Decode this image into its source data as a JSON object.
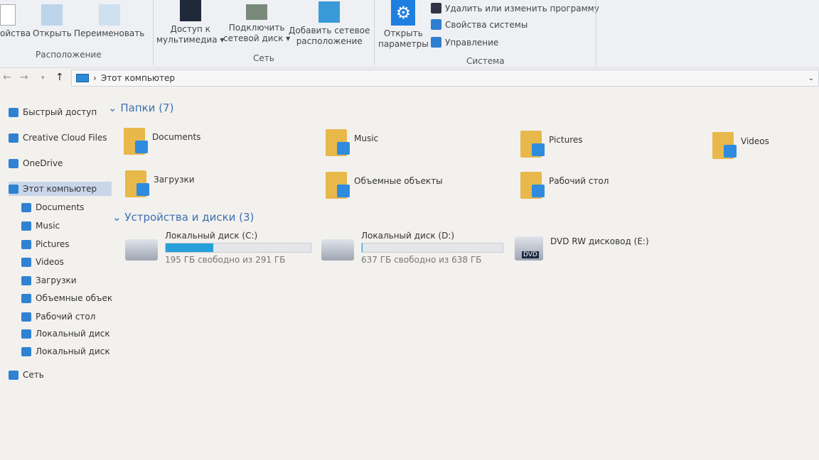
{
  "ribbon": {
    "location": {
      "label": "Расположение",
      "buttons": [
        "ойства",
        "Открыть",
        "Переименовать"
      ]
    },
    "network": {
      "label": "Сеть",
      "buttons": [
        {
          "l1": "Доступ к",
          "l2": "мультимедиа ▾"
        },
        {
          "l1": "Подключить",
          "l2": "сетевой диск ▾"
        },
        {
          "l1": "Добавить сетевое",
          "l2": "расположение"
        }
      ]
    },
    "system": {
      "label": "Система",
      "open": {
        "l1": "Открыть",
        "l2": "параметры"
      },
      "items": [
        "Удалить или изменить программу",
        "Свойства системы",
        "Управление"
      ]
    }
  },
  "address": {
    "path": "Этот компьютер",
    "separator": "›"
  },
  "sidebar": {
    "items": [
      {
        "label": "Быстрый доступ",
        "icon": "star-icon"
      },
      {
        "label": "Creative Cloud Files",
        "icon": "folder-icon"
      },
      {
        "label": "OneDrive",
        "icon": "cloud-icon"
      },
      {
        "label": "Этот компьютер",
        "icon": "computer-icon",
        "selected": true
      },
      {
        "label": "Documents",
        "icon": "documents-icon",
        "sub": true
      },
      {
        "label": "Music",
        "icon": "music-icon",
        "sub": true
      },
      {
        "label": "Pictures",
        "icon": "pictures-icon",
        "sub": true
      },
      {
        "label": "Videos",
        "icon": "videos-icon",
        "sub": true
      },
      {
        "label": "Загрузки",
        "icon": "download-icon",
        "sub": true
      },
      {
        "label": "Объемные объекты",
        "icon": "3d-objects-icon",
        "sub": true
      },
      {
        "label": "Рабочий стол",
        "icon": "desktop-icon",
        "sub": true
      },
      {
        "label": "Локальный диск (C:)",
        "icon": "drive-icon",
        "sub": true
      },
      {
        "label": "Локальный диск (D:)",
        "icon": "drive-icon",
        "sub": true
      },
      {
        "label": "Сеть",
        "icon": "network-icon"
      }
    ]
  },
  "folders": {
    "title": "Папки (7)",
    "items": [
      "Documents",
      "Music",
      "Pictures",
      "Videos",
      "Загрузки",
      "Объемные объекты",
      "Рабочий стол"
    ]
  },
  "devices": {
    "title": "Устройства и диски (3)",
    "items": [
      {
        "name": "Локальный диск (C:)",
        "free": "195 ГБ свободно из 291 ГБ",
        "used_percent": 33
      },
      {
        "name": "Локальный диск (D:)",
        "free": "637 ГБ свободно из 638 ГБ",
        "used_percent": 0.2
      },
      {
        "name": "DVD RW дисковод (E:)",
        "badge": "DVD"
      }
    ]
  },
  "colors": {
    "accent": "#27a0da",
    "folder": "#e8b84a"
  }
}
